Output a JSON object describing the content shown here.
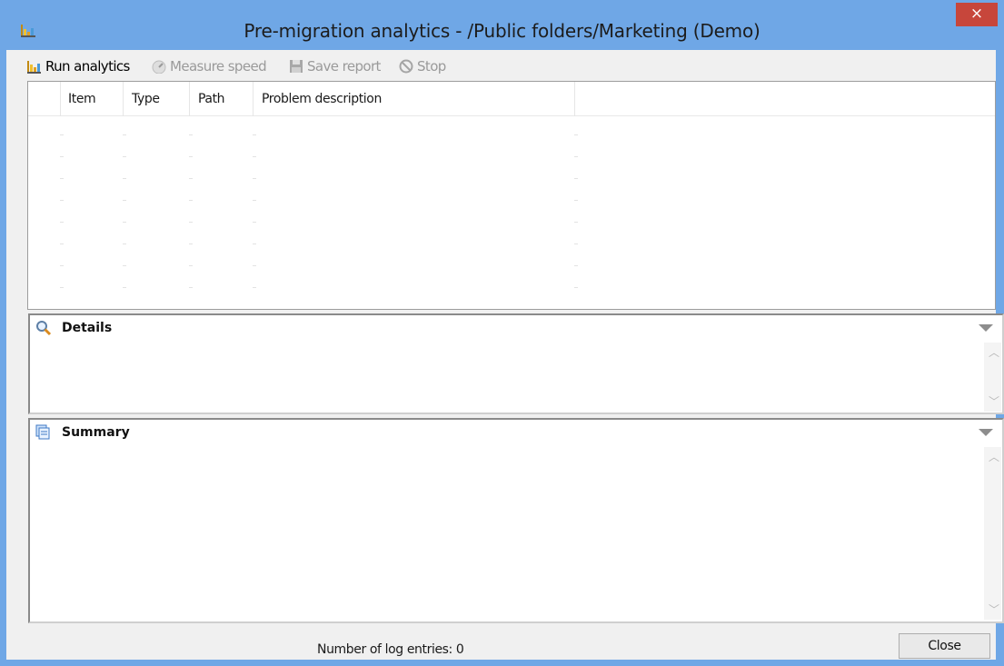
{
  "window": {
    "title": "Pre-migration analytics - /Public folders/Marketing (Demo)",
    "close_glyph": "×",
    "accent_color": "#6fa7e6"
  },
  "toolbar": {
    "run_analytics": "Run analytics",
    "measure_speed": "Measure speed",
    "save_report": "Save report",
    "stop": "Stop"
  },
  "grid": {
    "columns": [
      "Item",
      "Type",
      "Path",
      "Problem description"
    ],
    "rows": []
  },
  "details": {
    "title": "Details",
    "icon": "magnifier-icon"
  },
  "summary": {
    "title": "Summary",
    "icon": "pages-icon"
  },
  "status": {
    "log_entries": "Number of log entries: 0"
  },
  "buttons": {
    "close": "Close"
  }
}
